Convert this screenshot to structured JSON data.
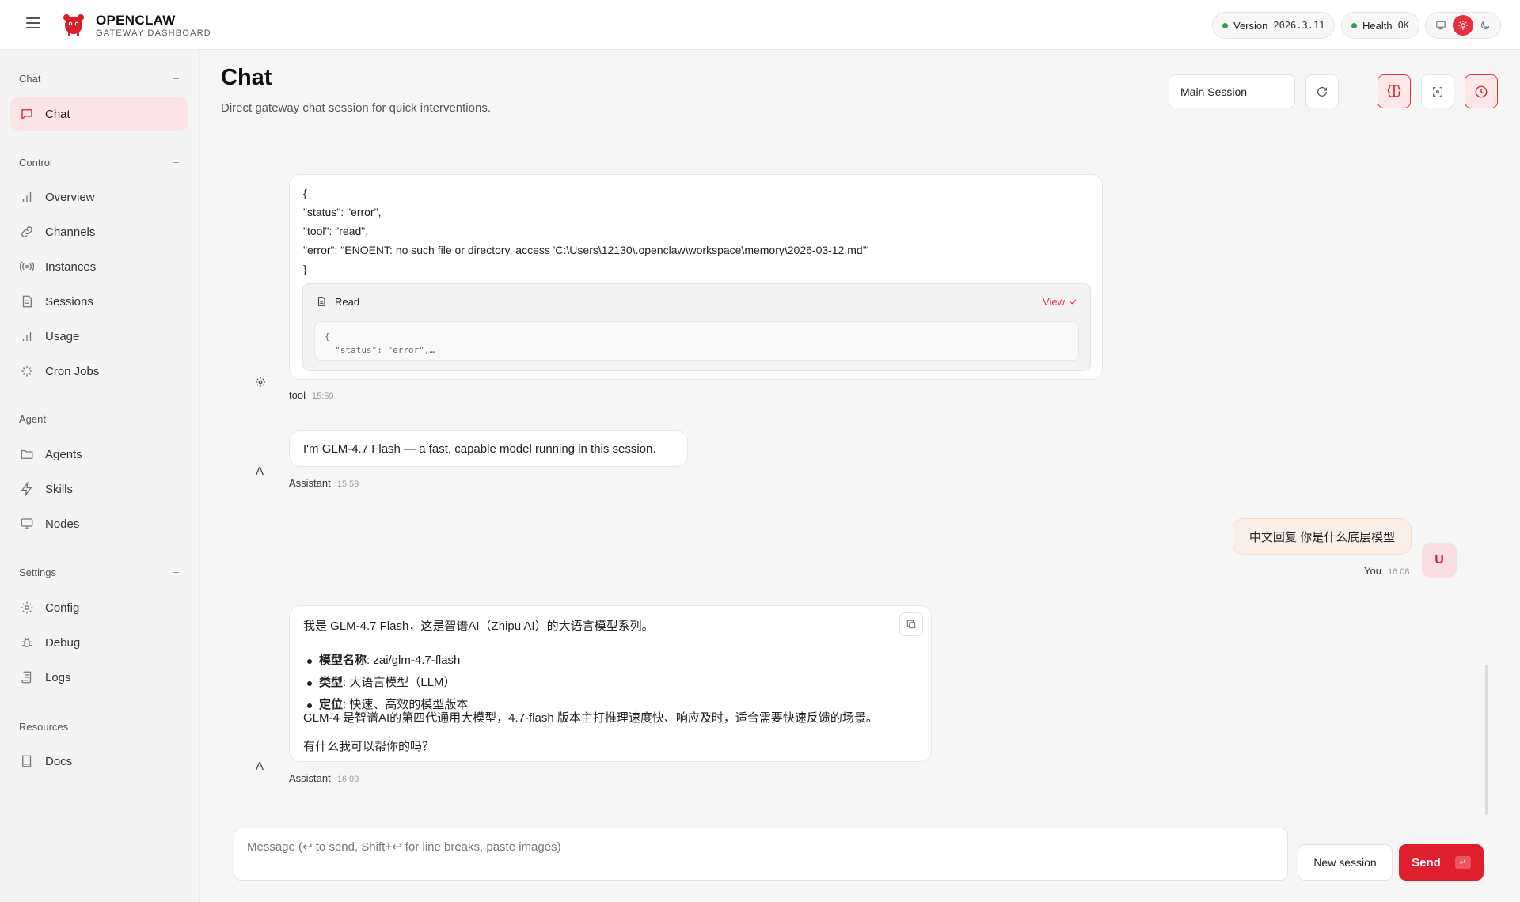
{
  "brand": {
    "name": "OPENCLAW",
    "subtitle": "GATEWAY DASHBOARD"
  },
  "status": {
    "version_label": "Version",
    "version_value": "2026.3.11",
    "health_label": "Health",
    "health_value": "OK",
    "ok_color": "#22a350"
  },
  "theme": {
    "options": [
      "monitor-icon",
      "sun-icon",
      "moon-icon"
    ],
    "selected": "sun-icon",
    "accent": "#e5303d"
  },
  "sidebar": {
    "groups": [
      {
        "label": "Chat",
        "items": [
          {
            "label": "Chat",
            "icon": "message-square-icon",
            "active": true
          }
        ]
      },
      {
        "label": "Control",
        "items": [
          {
            "label": "Overview",
            "icon": "bar-chart-icon"
          },
          {
            "label": "Channels",
            "icon": "link-icon"
          },
          {
            "label": "Instances",
            "icon": "radio-icon"
          },
          {
            "label": "Sessions",
            "icon": "file-text-icon"
          },
          {
            "label": "Usage",
            "icon": "bar-chart-icon"
          },
          {
            "label": "Cron Jobs",
            "icon": "loader-icon"
          }
        ]
      },
      {
        "label": "Agent",
        "items": [
          {
            "label": "Agents",
            "icon": "folder-icon"
          },
          {
            "label": "Skills",
            "icon": "zap-icon"
          },
          {
            "label": "Nodes",
            "icon": "monitor-icon"
          }
        ]
      },
      {
        "label": "Settings",
        "items": [
          {
            "label": "Config",
            "icon": "settings-icon"
          },
          {
            "label": "Debug",
            "icon": "bug-icon"
          },
          {
            "label": "Logs",
            "icon": "scroll-icon"
          }
        ]
      },
      {
        "label": "Resources",
        "items": [
          {
            "label": "Docs",
            "icon": "book-icon"
          }
        ]
      }
    ]
  },
  "page": {
    "title": "Chat",
    "subtitle": "Direct gateway chat session for quick interventions.",
    "session_select": "Main Session"
  },
  "messages": {
    "tool": {
      "json_lines": [
        "{",
        "\"status\": \"error\",",
        "\"tool\": \"read\",",
        "\"error\": \"ENOENT: no such file or directory, access 'C:\\Users\\12130\\.openclaw\\workspace\\memory\\2026-03-12.md'\"",
        "}"
      ],
      "card_title": "Read",
      "card_view": "View",
      "card_preview_1": "{",
      "card_preview_2": "  \"status\": \"error\",…",
      "sender": "tool",
      "time": "15:59"
    },
    "assistant1": {
      "text": "I'm GLM-4.7 Flash — a fast, capable model running in this session.",
      "avatar": "A",
      "sender": "Assistant",
      "time": "15:59"
    },
    "user": {
      "text": "中文回复 你是什么底层模型",
      "avatar": "U",
      "sender": "You",
      "time": "16:08"
    },
    "assistant2": {
      "intro": "我是 GLM-4.7 Flash，这是智谱AI（Zhipu AI）的大语言模型系列。",
      "items": [
        {
          "key": "模型名称",
          "value": ": zai/glm-4.7-flash"
        },
        {
          "key": "类型",
          "value": ": 大语言模型（LLM）"
        },
        {
          "key": "定位",
          "value": ": 快速、高效的模型版本"
        }
      ],
      "para": "GLM-4 是智谱AI的第四代通用大模型，4.7-flash 版本主打推理速度快、响应及时，适合需要快速反馈的场景。",
      "question": "有什么我可以帮你的吗？",
      "avatar": "A",
      "sender": "Assistant",
      "time": "16:09"
    }
  },
  "composer": {
    "placeholder": "Message (↩ to send, Shift+↩ for line breaks, paste images)",
    "new_session": "New session",
    "send": "Send",
    "send_kbd": "↵"
  }
}
